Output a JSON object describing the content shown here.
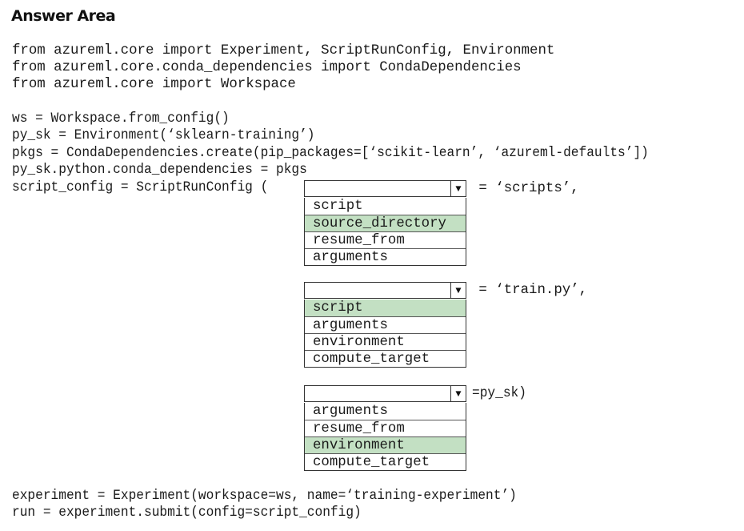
{
  "title": "Answer Area",
  "imports": [
    "from azureml.core import Experiment, ScriptRunConfig, Environment",
    "from azureml.core.conda_dependencies import CondaDependencies",
    "from azureml.core import Workspace"
  ],
  "setup": [
    "ws = Workspace.from_config()",
    "py_sk = Environment(‘sklearn-training’)",
    "pkgs = CondaDependencies.create(pip_packages=[‘scikit-learn’, ‘azureml-defaults’])",
    "py_sk.python.conda_dependencies = pkgs"
  ],
  "config_prefix": "script_config = ScriptRunConfig (",
  "dropdowns": [
    {
      "selected": "",
      "suffix": " = ‘scripts’,",
      "options": [
        {
          "label": "script",
          "highlighted": false
        },
        {
          "label": "source_directory",
          "highlighted": true
        },
        {
          "label": "resume_from",
          "highlighted": false
        },
        {
          "label": "arguments",
          "highlighted": false
        }
      ]
    },
    {
      "selected": "",
      "suffix": " = ‘train.py’,",
      "options": [
        {
          "label": "script",
          "highlighted": true
        },
        {
          "label": "arguments",
          "highlighted": false
        },
        {
          "label": "environment",
          "highlighted": false
        },
        {
          "label": "compute_target",
          "highlighted": false
        }
      ]
    },
    {
      "selected": "",
      "suffix": "=py_sk)",
      "options": [
        {
          "label": "arguments",
          "highlighted": false
        },
        {
          "label": "resume_from",
          "highlighted": false
        },
        {
          "label": "environment",
          "highlighted": true
        },
        {
          "label": "compute_target",
          "highlighted": false
        }
      ]
    }
  ],
  "footer": [
    "experiment = Experiment(workspace=ws, name=‘training-experiment’)",
    "run = experiment.submit(config=script_config)"
  ],
  "arrow_glyph": "▼",
  "colors": {
    "highlight": "#c3e0c3",
    "border": "#333333"
  }
}
